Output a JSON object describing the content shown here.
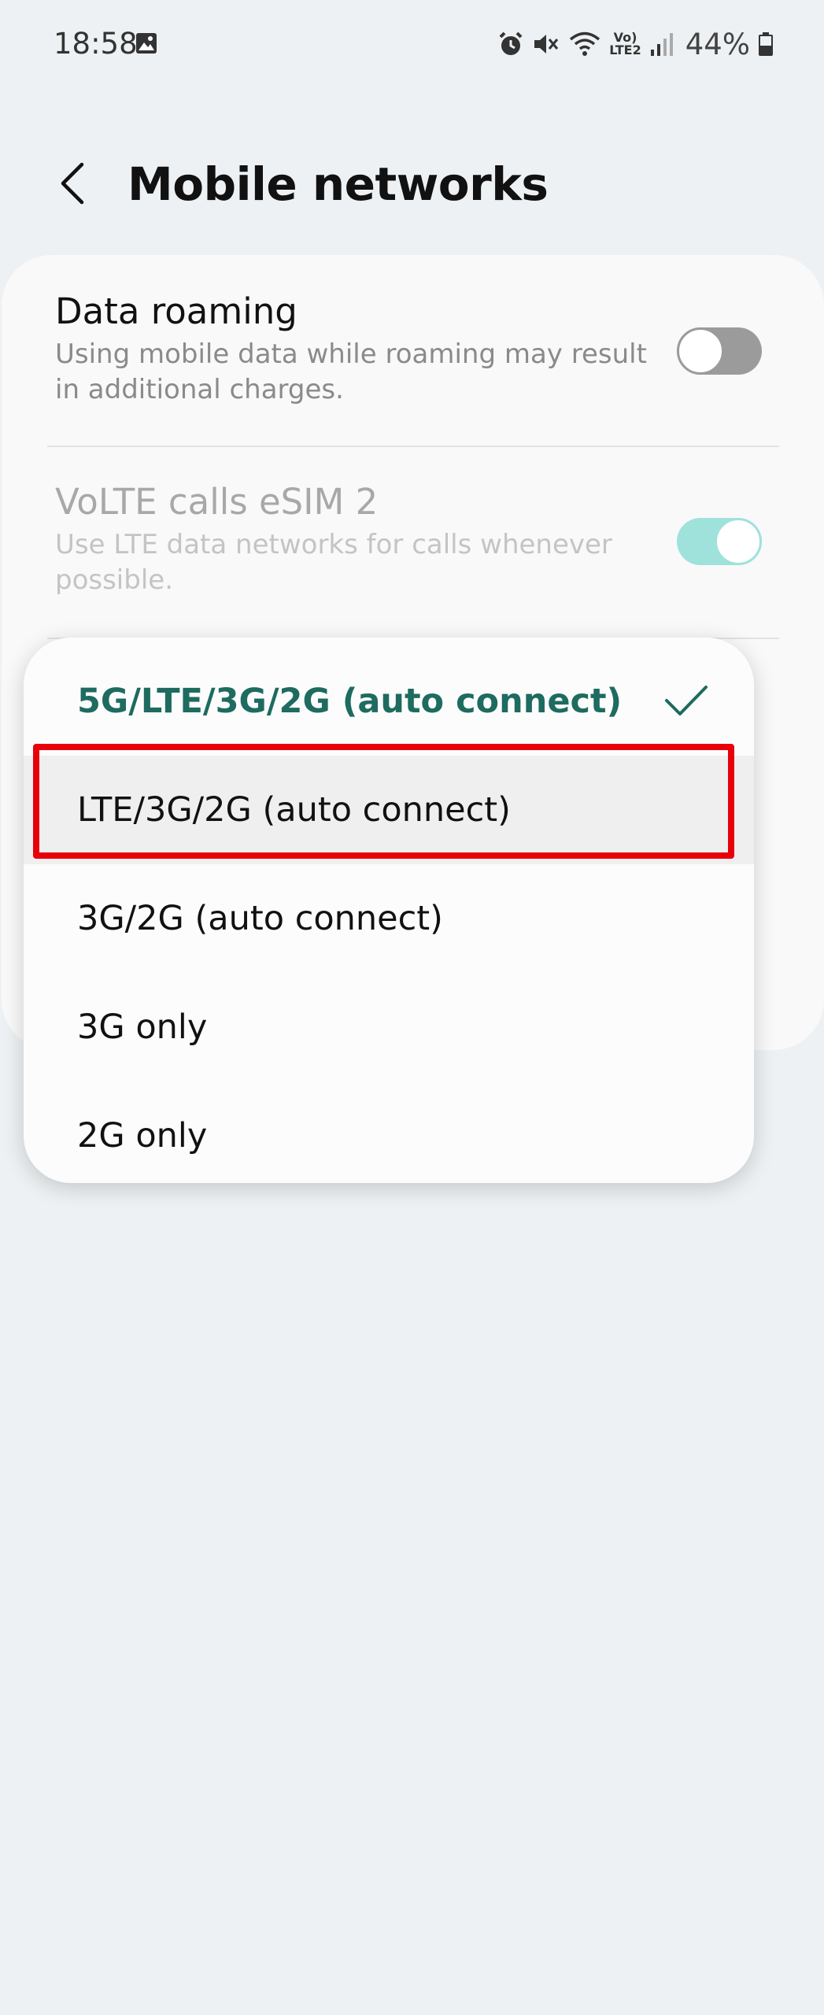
{
  "status_bar": {
    "time": "18:58",
    "battery": "44%",
    "icons": [
      "gallery-icon",
      "alarm-icon",
      "mute-icon",
      "wifi-icon",
      "volte-lte2-icon",
      "signal-icon",
      "battery-icon"
    ],
    "volte_label": "Vo)",
    "lte_label": "LTE2"
  },
  "header": {
    "title": "Mobile networks",
    "back_icon": "chevron-left-icon"
  },
  "settings": {
    "data_roaming": {
      "title": "Data roaming",
      "subtitle": "Using mobile data while roaming may result in additional charges.",
      "enabled": false
    },
    "volte": {
      "title": "VoLTE calls eSIM 2",
      "subtitle": "Use LTE data networks for calls whenever possible.",
      "enabled": true
    }
  },
  "network_mode_menu": {
    "options": [
      {
        "label": "5G/LTE/3G/2G (auto connect)",
        "selected": true
      },
      {
        "label": "LTE/3G/2G (auto connect)",
        "selected": false
      },
      {
        "label": "3G/2G (auto connect)",
        "selected": false
      },
      {
        "label": "3G only",
        "selected": false
      },
      {
        "label": "2G only",
        "selected": false
      }
    ],
    "highlighted_index": 1,
    "check_icon": "checkmark-icon"
  },
  "colors": {
    "accent": "#1e6b60",
    "toggle_on": "#9fe2dc",
    "toggle_off": "#9b9b9b",
    "highlight_border": "#e8000b",
    "background": "#eef1f3"
  }
}
